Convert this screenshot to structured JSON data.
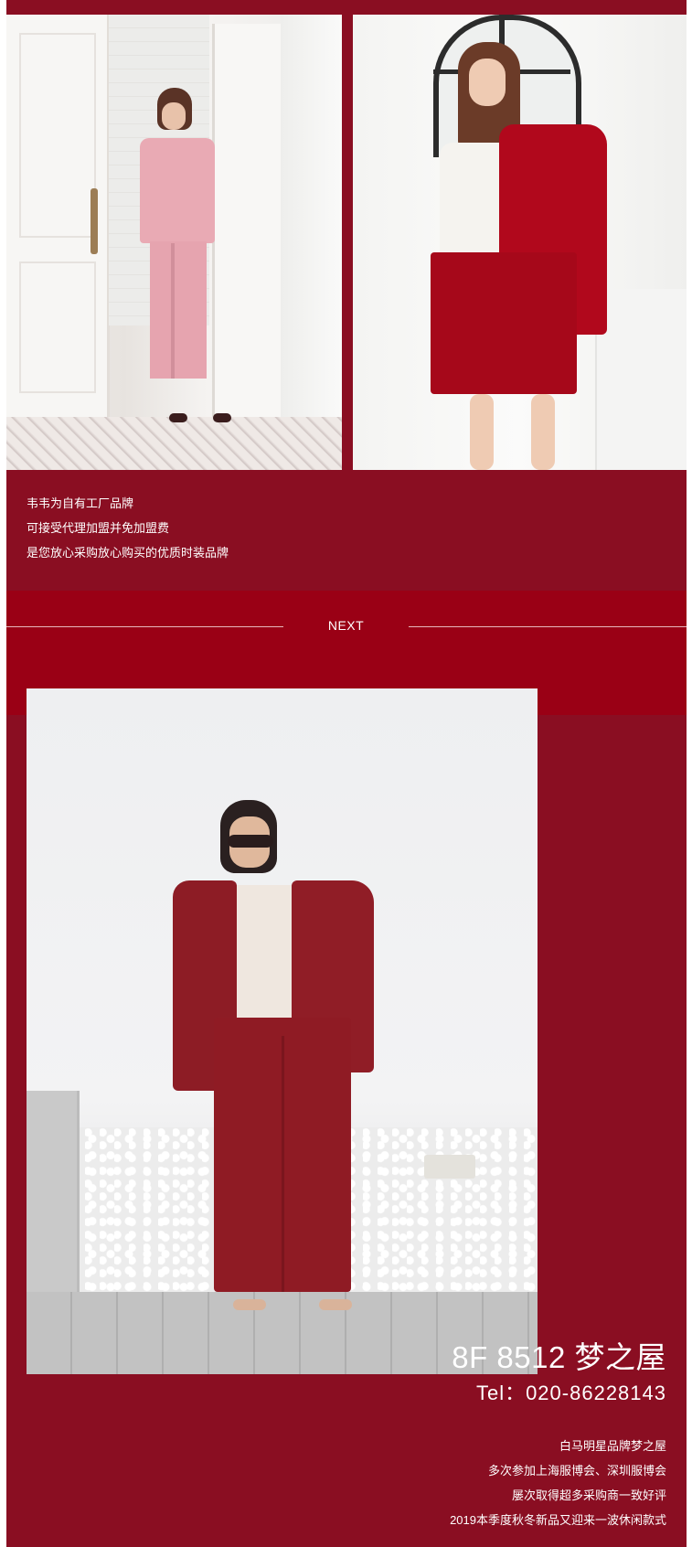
{
  "intro": {
    "lines": [
      "韦韦为自有工厂品牌",
      "可接受代理加盟并免加盟费",
      "是您放心采购放心购买的优质时装品牌"
    ]
  },
  "divider": {
    "label": "NEXT"
  },
  "contact": {
    "shop": "8F 8512 梦之屋",
    "tel": "Tel：020-86228143"
  },
  "description": {
    "lines": [
      "白马明星品牌梦之屋",
      "多次参加上海服博会、深圳服博会",
      "屡次取得超多采购商一致好评",
      "2019本季度秋冬新品又迎来一波休闲款式"
    ]
  },
  "colors": {
    "background": "#8a0e22",
    "band": "#9a0015",
    "text": "#ffffff"
  }
}
